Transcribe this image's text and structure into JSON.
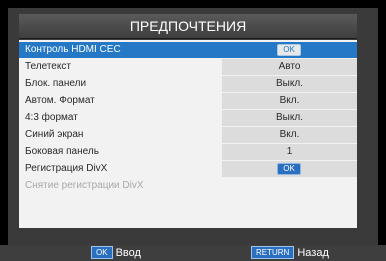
{
  "title": "ПРЕДПОЧТЕНИЯ",
  "colors": {
    "selection": "#2478c6",
    "key_badge": "#2a6fc0"
  },
  "menu": [
    {
      "label": "Контроль HDMI CEC",
      "value": "OK",
      "type": "button",
      "selected": true
    },
    {
      "label": "Телетекст",
      "value": "Авто",
      "type": "text"
    },
    {
      "label": "Блок. панели",
      "value": "Выкл.",
      "type": "text"
    },
    {
      "label": "Автом. Формат",
      "value": "Вкл.",
      "type": "text"
    },
    {
      "label": "4:3 формат",
      "value": "Выкл.",
      "type": "text"
    },
    {
      "label": "Синий экран",
      "value": "Вкл.",
      "type": "text"
    },
    {
      "label": "Боковая панель",
      "value": "1",
      "type": "text"
    },
    {
      "label": "Регистрация DivX",
      "value": "OK",
      "type": "button"
    },
    {
      "label": "Снятие регистрации DivX",
      "value": "",
      "type": "disabled"
    }
  ],
  "footer": {
    "enter_key": "OK",
    "enter_label": "Ввод",
    "back_key": "RETURN",
    "back_label": "Назад"
  }
}
